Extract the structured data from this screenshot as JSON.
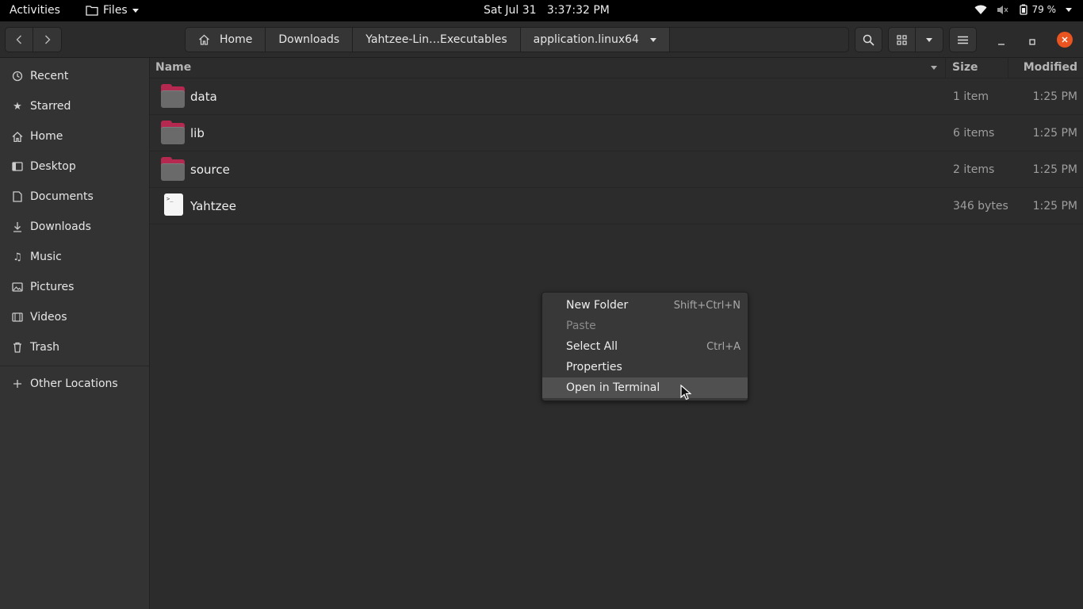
{
  "topbar": {
    "activities": "Activities",
    "app_menu": "Files",
    "clock": "Sat Jul 31   3:37:32 PM",
    "battery": "79 %",
    "icons": [
      "wifi-icon",
      "volume-muted-icon",
      "battery-icon",
      "system-menu-arrow-icon"
    ]
  },
  "header": {
    "path": [
      "Home",
      "Downloads",
      "Yahtzee-Lin…Executables",
      "application.linux64"
    ],
    "buttons": [
      "back-icon",
      "forward-icon",
      "search-icon",
      "grid-view-icon",
      "view-options-icon",
      "hamburger-menu-icon",
      "minimize-icon",
      "maximize-icon",
      "close-icon"
    ]
  },
  "sidebar": {
    "items": [
      {
        "label": "Recent",
        "icon": "clock-icon"
      },
      {
        "label": "Starred",
        "icon": "star-icon"
      },
      {
        "label": "Home",
        "icon": "home-icon"
      },
      {
        "label": "Desktop",
        "icon": "desktop-icon"
      },
      {
        "label": "Documents",
        "icon": "document-icon"
      },
      {
        "label": "Downloads",
        "icon": "download-icon"
      },
      {
        "label": "Music",
        "icon": "music-icon"
      },
      {
        "label": "Pictures",
        "icon": "picture-icon"
      },
      {
        "label": "Videos",
        "icon": "video-icon"
      },
      {
        "label": "Trash",
        "icon": "trash-icon"
      }
    ],
    "other_locations": "Other Locations"
  },
  "columns": {
    "name": "Name",
    "size": "Size",
    "modified": "Modified"
  },
  "files": [
    {
      "name": "data",
      "size": "1 item",
      "modified": "1:25 PM",
      "type": "folder"
    },
    {
      "name": "lib",
      "size": "6 items",
      "modified": "1:25 PM",
      "type": "folder"
    },
    {
      "name": "source",
      "size": "2 items",
      "modified": "1:25 PM",
      "type": "folder"
    },
    {
      "name": "Yahtzee",
      "size": "346 bytes",
      "modified": "1:25 PM",
      "type": "executable"
    }
  ],
  "context_menu": {
    "items": [
      {
        "label": "New Folder",
        "accel": "Shift+Ctrl+N"
      },
      {
        "label": "Paste",
        "accel": ""
      },
      {
        "label": "Select All",
        "accel": "Ctrl+A"
      },
      {
        "label": "Properties",
        "accel": ""
      },
      {
        "label": "Open in Terminal",
        "accel": ""
      }
    ]
  },
  "colors": {
    "accent_close": "#e95420",
    "folder_tab": "#b5284f",
    "background": "#2c2c2c"
  }
}
